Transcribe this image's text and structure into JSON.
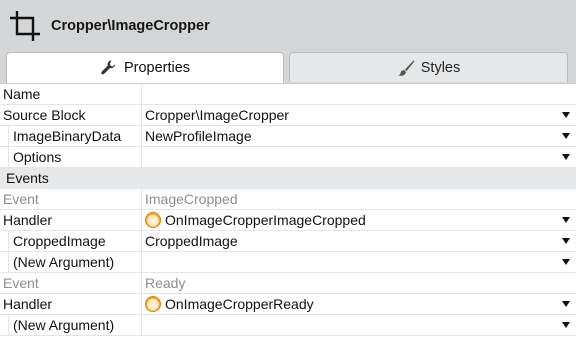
{
  "header": {
    "title": "Cropper\\ImageCropper",
    "icon": "crop-icon"
  },
  "tabs": [
    {
      "label": "Properties",
      "icon": "wrench-icon",
      "active": true
    },
    {
      "label": "Styles",
      "icon": "brush-icon",
      "active": false
    }
  ],
  "rows": {
    "name": {
      "label": "Name",
      "value": ""
    },
    "source_block": {
      "label": "Source Block",
      "value": "Cropper\\ImageCropper"
    },
    "image_binary_data": {
      "label": "ImageBinaryData",
      "value": "NewProfileImage"
    },
    "options": {
      "label": "Options",
      "value": ""
    },
    "events_section": {
      "label": "Events"
    },
    "event1": {
      "label": "Event",
      "value": "ImageCropped"
    },
    "handler1": {
      "label": "Handler",
      "value": "OnImageCropperImageCropped"
    },
    "cropped_image": {
      "label": "CroppedImage",
      "value": "CroppedImage"
    },
    "new_argument1": {
      "label": "(New Argument)",
      "value": ""
    },
    "event2": {
      "label": "Event",
      "value": "Ready"
    },
    "handler2": {
      "label": "Handler",
      "value": "OnImageCropperReady"
    },
    "new_argument2": {
      "label": "(New Argument)",
      "value": ""
    }
  },
  "colors": {
    "background": "#d4d6d7",
    "panel": "#ffffff",
    "section": "#e7e8e9",
    "muted_text": "#8b8d90",
    "handler_icon": "#f3b045"
  }
}
